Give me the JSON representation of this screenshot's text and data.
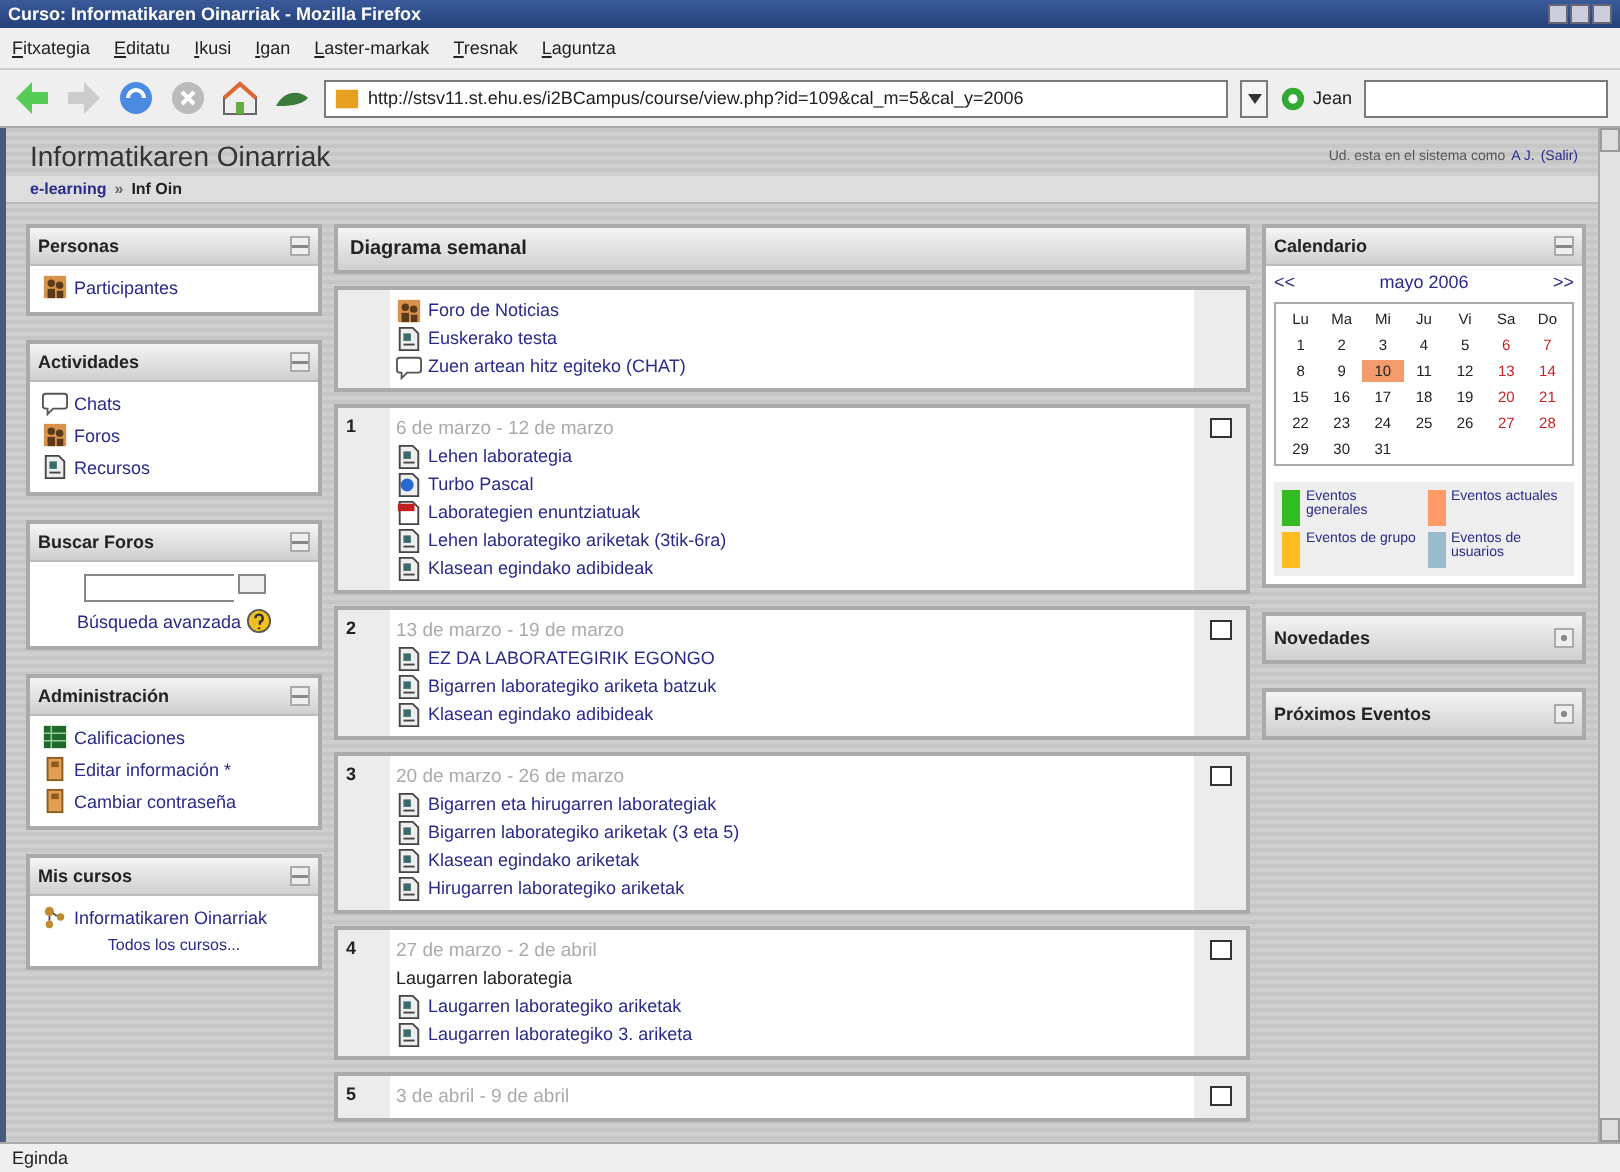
{
  "window": {
    "title": "Curso: Informatikaren Oinarriak - Mozilla Firefox"
  },
  "menu": [
    "Fitxategia",
    "Editatu",
    "Ikusi",
    "Igan",
    "Laster-markak",
    "Tresnak",
    "Laguntza"
  ],
  "toolbar": {
    "address": "http://stsv11.st.ehu.es/i2BCampus/course/view.php?id=109&cal_m=5&cal_y=2006",
    "profile": "Jean"
  },
  "page": {
    "title": "Informatikaren Oinarriak",
    "login_text": "Ud. esta en el sistema como",
    "login_user": "A J.",
    "logout": "(Salir)",
    "breadcrumb": [
      {
        "text": "e-learning",
        "kind": "link"
      },
      {
        "text": "»",
        "kind": "sep"
      },
      {
        "text": "Inf Oin",
        "kind": "current"
      }
    ]
  },
  "left_blocks": [
    {
      "title": "Personas",
      "expanded": true,
      "kind": "links",
      "items": [
        {
          "text": "Participantes",
          "kind": "people"
        }
      ]
    },
    {
      "title": "Actividades",
      "expanded": true,
      "kind": "links",
      "items": [
        {
          "text": "Chats",
          "kind": "chat"
        },
        {
          "text": "Foros",
          "kind": "forum"
        },
        {
          "text": "Recursos",
          "kind": "doc"
        }
      ]
    },
    {
      "title": "Buscar Foros",
      "expanded": true,
      "kind": "search",
      "link": "Búsqueda avanzada"
    },
    {
      "title": "Administración",
      "expanded": true,
      "kind": "links",
      "items": [
        {
          "text": "Calificaciones",
          "kind": "grades"
        },
        {
          "text": "Editar información *",
          "kind": "edit"
        },
        {
          "text": "Cambiar contraseña",
          "kind": "edit"
        }
      ]
    },
    {
      "title": "Mis cursos",
      "expanded": true,
      "kind": "courses",
      "items": [
        {
          "text": "Informatikaren Oinarriak",
          "kind": "course"
        }
      ],
      "more": "Todos los cursos..."
    }
  ],
  "weekly": {
    "title": "Diagrama semanal",
    "sections": [
      {
        "items": [
          {
            "text": "Foro de Noticias",
            "kind": "forum"
          },
          {
            "text": "Euskerako testa",
            "kind": "doc"
          },
          {
            "text": "Zuen artean hitz egiteko (CHAT)",
            "kind": "chat"
          }
        ]
      },
      {
        "number": "1",
        "dates": "6 de marzo - 12 de marzo",
        "items": [
          {
            "text": "Lehen laborategia",
            "kind": "doc"
          },
          {
            "text": "Turbo Pascal",
            "kind": "pascal"
          },
          {
            "text": "Laborategien enuntziatuak",
            "kind": "pdf"
          },
          {
            "text": "Lehen laborategiko ariketak (3tik-6ra)",
            "kind": "doc"
          },
          {
            "text": "Klasean egindako adibideak",
            "kind": "doc"
          }
        ]
      },
      {
        "number": "2",
        "dates": "13 de marzo - 19 de marzo",
        "items": [
          {
            "text": "EZ DA LABORATEGIRIK EGONGO",
            "kind": "doc"
          },
          {
            "text": "Bigarren laborategiko ariketa batzuk",
            "kind": "doc"
          },
          {
            "text": "Klasean egindako adibideak",
            "kind": "doc"
          }
        ]
      },
      {
        "number": "3",
        "dates": "20 de marzo - 26 de marzo",
        "items": [
          {
            "text": "Bigarren eta hirugarren laborategiak",
            "kind": "doc"
          },
          {
            "text": "Bigarren laborategiko ariketak (3 eta 5)",
            "kind": "doc"
          },
          {
            "text": "Klasean egindako ariketak",
            "kind": "doc"
          },
          {
            "text": "Hirugarren laborategiko ariketak",
            "kind": "doc"
          }
        ]
      },
      {
        "number": "4",
        "dates": "27 de marzo - 2 de abril",
        "items": [
          {
            "text": "Laugarren laborategia",
            "kind": "label"
          },
          {
            "text": "Laugarren laborategiko ariketak",
            "kind": "doc"
          },
          {
            "text": "Laugarren laborategiko 3. ariketa",
            "kind": "doc"
          }
        ]
      },
      {
        "number": "5",
        "dates": "3 de abril - 9 de abril"
      }
    ]
  },
  "calendar": {
    "title": "Calendario",
    "expanded": true,
    "prev": "<<",
    "month": "mayo 2006",
    "next": ">>",
    "weekdays": [
      "Lu",
      "Ma",
      "Mi",
      "Ju",
      "Vi",
      "Sa",
      "Do"
    ],
    "weeks": [
      [
        {
          "day": "1",
          "weekend": false,
          "selected": false
        },
        {
          "day": "2",
          "weekend": false,
          "selected": false
        },
        {
          "day": "3",
          "weekend": false,
          "selected": false
        },
        {
          "day": "4",
          "weekend": false,
          "selected": false
        },
        {
          "day": "5",
          "weekend": false,
          "selected": false
        },
        {
          "day": "6",
          "weekend": true,
          "selected": false
        },
        {
          "day": "7",
          "weekend": true,
          "selected": false
        }
      ],
      [
        {
          "day": "8",
          "weekend": false,
          "selected": false
        },
        {
          "day": "9",
          "weekend": false,
          "selected": false
        },
        {
          "day": "10",
          "weekend": false,
          "selected": true
        },
        {
          "day": "11",
          "weekend": false,
          "selected": false
        },
        {
          "day": "12",
          "weekend": false,
          "selected": false
        },
        {
          "day": "13",
          "weekend": true,
          "selected": false
        },
        {
          "day": "14",
          "weekend": true,
          "selected": false
        }
      ],
      [
        {
          "day": "15",
          "weekend": false,
          "selected": false
        },
        {
          "day": "16",
          "weekend": false,
          "selected": false
        },
        {
          "day": "17",
          "weekend": false,
          "selected": false
        },
        {
          "day": "18",
          "weekend": false,
          "selected": false
        },
        {
          "day": "19",
          "weekend": false,
          "selected": false
        },
        {
          "day": "20",
          "weekend": true,
          "selected": false
        },
        {
          "day": "21",
          "weekend": true,
          "selected": false
        }
      ],
      [
        {
          "day": "22",
          "weekend": false,
          "selected": false
        },
        {
          "day": "23",
          "weekend": false,
          "selected": false
        },
        {
          "day": "24",
          "weekend": false,
          "selected": false
        },
        {
          "day": "25",
          "weekend": false,
          "selected": false
        },
        {
          "day": "26",
          "weekend": false,
          "selected": false
        },
        {
          "day": "27",
          "weekend": true,
          "selected": false
        },
        {
          "day": "28",
          "weekend": true,
          "selected": false
        }
      ],
      [
        {
          "day": "29",
          "weekend": false,
          "selected": false
        },
        {
          "day": "30",
          "weekend": false,
          "selected": false
        },
        {
          "day": "31",
          "weekend": false,
          "selected": false
        }
      ]
    ],
    "legend": [
      {
        "text": "Eventos generales",
        "color": "#33bb22"
      },
      {
        "text": "Eventos actuales",
        "color": "#ff9966"
      },
      {
        "text": "Eventos de grupo",
        "color": "#ffbb22"
      },
      {
        "text": "Eventos de usuarios",
        "color": "#99bbcc"
      }
    ]
  },
  "right_blocks": [
    {
      "title": "Novedades",
      "expanded": false
    },
    {
      "title": "Próximos Eventos",
      "expanded": false
    }
  ],
  "status_bar": "Eginda"
}
